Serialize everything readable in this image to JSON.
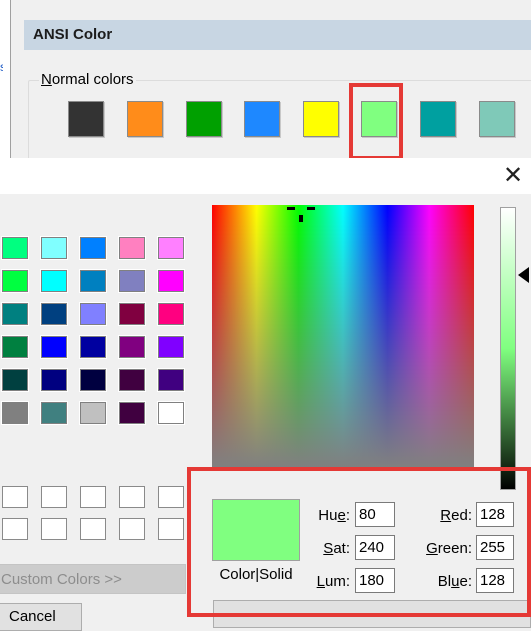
{
  "ansi_panel": {
    "title": "ANSI Color",
    "group_label_underlined": "N",
    "group_label_rest": "ormal colors",
    "left_strip_char": "s",
    "swatches": [
      {
        "name": "black",
        "color": "#333333"
      },
      {
        "name": "orange",
        "color": "#ff8c1a"
      },
      {
        "name": "green",
        "color": "#00a000"
      },
      {
        "name": "blue",
        "color": "#1e88ff"
      },
      {
        "name": "yellow",
        "color": "#ffff00"
      },
      {
        "name": "light-green",
        "color": "#80ff80",
        "highlighted": true
      },
      {
        "name": "teal",
        "color": "#00a0a0"
      },
      {
        "name": "mint",
        "color": "#7fc9b8"
      }
    ]
  },
  "color_dialog": {
    "close_glyph": "✕",
    "basic_colors": [
      [
        "#00ff80",
        "#80ffff",
        "#0080ff",
        "#ff80c0",
        "#ff80ff"
      ],
      [
        "#00ff40",
        "#00ffff",
        "#0080c0",
        "#8080c0",
        "#ff00ff"
      ],
      [
        "#008080",
        "#004080",
        "#8080ff",
        "#800040",
        "#ff0080"
      ],
      [
        "#008040",
        "#0000ff",
        "#0000a0",
        "#800080",
        "#8000ff"
      ],
      [
        "#004040",
        "#000080",
        "#000040",
        "#400040",
        "#400080"
      ],
      [
        "#808080",
        "#408080",
        "#c0c0c0",
        "#400040",
        "#ffffff"
      ]
    ],
    "custom_colors_rows": 2,
    "custom_colors_cols": 5,
    "define_custom_label": "Custom Colors >>",
    "cancel_label": "Cancel",
    "preview_color": "#80ff80",
    "color_solid_label": "Color|Solid",
    "fields": {
      "hue": {
        "label_u": "e",
        "label_pre": "Hu",
        "label_post": ":",
        "value": "80"
      },
      "sat": {
        "label_u": "S",
        "label_pre": "",
        "label_post": "at:",
        "value": "240"
      },
      "lum": {
        "label_u": "L",
        "label_pre": "",
        "label_post": "um:",
        "value": "180"
      },
      "red": {
        "label_u": "R",
        "label_pre": "",
        "label_post": "ed:",
        "value": "128"
      },
      "green": {
        "label_u": "G",
        "label_pre": "",
        "label_post": "reen:",
        "value": "255"
      },
      "blue": {
        "label_u": "u",
        "label_pre": "Bl",
        "label_post": "e:",
        "value": "128"
      }
    },
    "highlight_color": "#e53935"
  }
}
